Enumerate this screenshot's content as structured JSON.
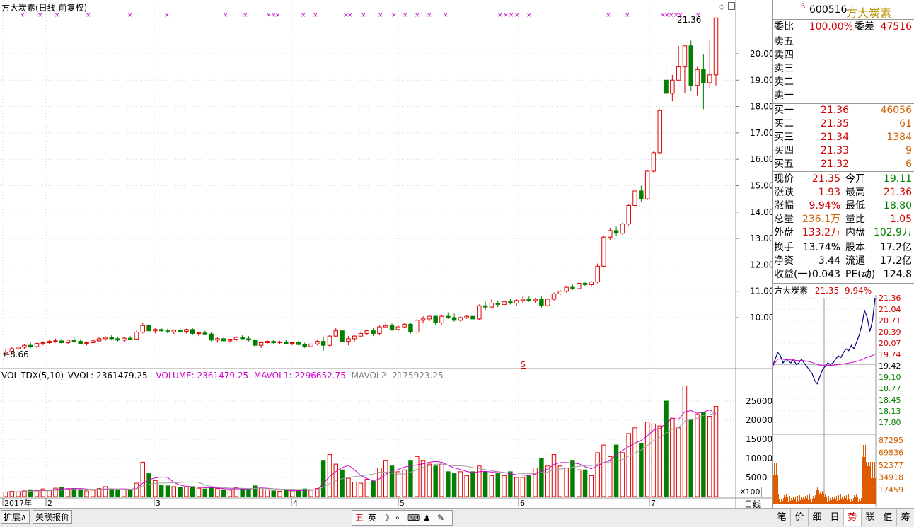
{
  "header": {
    "title": "方大炭素(日线 前复权)",
    "last_price_label": "21.36",
    "low_label": "8.66",
    "marker_s": "S"
  },
  "price_axis": [
    "20.00",
    "19.00",
    "18.00",
    "17.00",
    "16.00",
    "15.00",
    "14.00",
    "13.00",
    "12.00",
    "11.00",
    "10.00"
  ],
  "volume_header": {
    "name": "VOL-TDX(5,10)",
    "vvol": "VVOL: 2361479.25",
    "volume": "VOLUME: 2361479.25",
    "mavol1": "MAVOL1: 2296652.75",
    "mavol2": "MAVOL2: 2175923.25"
  },
  "volume_axis": [
    "25000",
    "20000",
    "15000",
    "10000",
    "5000"
  ],
  "volume_unit": "X100",
  "date_axis": [
    "2017年",
    "2",
    "3",
    "4",
    "5",
    "6",
    "7"
  ],
  "period_button": "日线",
  "chart_data": {
    "type": "candlestick",
    "title": "方大炭素(日线 前复权)",
    "price_range": [
      8.5,
      21.5
    ],
    "volume_range": [
      0,
      30000
    ],
    "colors": {
      "up": "#e00000",
      "down": "#008000",
      "ma1": "#d000d0",
      "ma2": "#a0a0a0"
    },
    "dates_months": [
      "2017年",
      "2",
      "3",
      "4",
      "5",
      "6",
      "7"
    ],
    "candles": [
      [
        8.66,
        8.8,
        8.6,
        8.7,
        1200
      ],
      [
        8.7,
        8.9,
        8.65,
        8.82,
        1400
      ],
      [
        8.82,
        8.95,
        8.75,
        8.88,
        1300
      ],
      [
        8.88,
        9.0,
        8.8,
        8.95,
        1500
      ],
      [
        8.95,
        9.05,
        8.85,
        8.9,
        1800
      ],
      [
        8.9,
        9.05,
        8.85,
        9.02,
        1600
      ],
      [
        9.02,
        9.1,
        8.95,
        9.05,
        2000
      ],
      [
        9.05,
        9.15,
        9.0,
        9.1,
        1700
      ],
      [
        9.1,
        9.2,
        9.05,
        9.12,
        2200
      ],
      [
        9.12,
        9.2,
        9.0,
        9.05,
        2500
      ],
      [
        9.05,
        9.18,
        9.0,
        9.15,
        2000
      ],
      [
        9.15,
        9.25,
        9.05,
        9.1,
        2100
      ],
      [
        9.1,
        9.18,
        9.0,
        9.02,
        1800
      ],
      [
        9.02,
        9.1,
        8.95,
        9.05,
        1500
      ],
      [
        9.05,
        9.15,
        9.0,
        9.12,
        1700
      ],
      [
        9.12,
        9.25,
        9.08,
        9.2,
        2100
      ],
      [
        9.2,
        9.3,
        9.12,
        9.25,
        2600
      ],
      [
        9.25,
        9.35,
        9.15,
        9.2,
        2000
      ],
      [
        9.2,
        9.28,
        9.1,
        9.15,
        1600
      ],
      [
        9.15,
        9.25,
        9.08,
        9.22,
        1800
      ],
      [
        9.22,
        9.3,
        9.15,
        9.18,
        1700
      ],
      [
        9.18,
        9.5,
        9.15,
        9.45,
        3500
      ],
      [
        9.45,
        9.8,
        9.4,
        9.7,
        9000
      ],
      [
        9.7,
        9.75,
        9.45,
        9.5,
        6000
      ],
      [
        9.5,
        9.6,
        9.4,
        9.55,
        4200
      ],
      [
        9.55,
        9.62,
        9.45,
        9.5,
        3000
      ],
      [
        9.5,
        9.58,
        9.4,
        9.45,
        2800
      ],
      [
        9.45,
        9.55,
        9.38,
        9.52,
        2600
      ],
      [
        9.52,
        9.6,
        9.42,
        9.48,
        2400
      ],
      [
        9.48,
        9.58,
        9.4,
        9.55,
        2500
      ],
      [
        9.55,
        9.6,
        9.35,
        9.4,
        2600
      ],
      [
        9.4,
        9.48,
        9.3,
        9.42,
        2200
      ],
      [
        9.42,
        9.5,
        9.35,
        9.38,
        2000
      ],
      [
        9.38,
        9.45,
        9.1,
        9.15,
        2400
      ],
      [
        9.15,
        9.25,
        9.05,
        9.2,
        2100
      ],
      [
        9.2,
        9.28,
        9.1,
        9.12,
        1800
      ],
      [
        9.12,
        9.2,
        9.05,
        9.18,
        1700
      ],
      [
        9.18,
        9.3,
        9.1,
        9.25,
        2300
      ],
      [
        9.25,
        9.35,
        9.15,
        9.2,
        2100
      ],
      [
        9.2,
        9.3,
        9.1,
        9.15,
        2000
      ],
      [
        9.15,
        9.22,
        8.85,
        8.95,
        2800
      ],
      [
        8.95,
        9.1,
        8.85,
        9.05,
        2200
      ],
      [
        9.05,
        9.15,
        9.0,
        9.1,
        1800
      ],
      [
        9.1,
        9.15,
        9.0,
        9.05,
        1500
      ],
      [
        9.05,
        9.12,
        8.98,
        9.08,
        1400
      ],
      [
        9.08,
        9.15,
        9.0,
        9.02,
        1600
      ],
      [
        9.02,
        9.08,
        8.95,
        9.05,
        1500
      ],
      [
        9.05,
        9.12,
        8.95,
        8.98,
        1800
      ],
      [
        8.98,
        9.05,
        8.85,
        8.9,
        2000
      ],
      [
        8.9,
        9.05,
        8.85,
        9.0,
        1700
      ],
      [
        9.0,
        9.15,
        8.95,
        9.1,
        2100
      ],
      [
        9.1,
        9.25,
        8.75,
        8.95,
        9500
      ],
      [
        8.95,
        9.35,
        8.9,
        9.3,
        11000
      ],
      [
        9.3,
        9.6,
        9.25,
        9.5,
        8500
      ],
      [
        9.5,
        9.55,
        9.0,
        9.1,
        7000
      ],
      [
        9.1,
        9.3,
        8.95,
        9.2,
        4800
      ],
      [
        9.2,
        9.35,
        9.1,
        9.3,
        3800
      ],
      [
        9.3,
        9.45,
        9.25,
        9.4,
        3500
      ],
      [
        9.4,
        9.55,
        9.35,
        9.5,
        4500
      ],
      [
        9.5,
        9.6,
        9.3,
        9.4,
        4000
      ],
      [
        9.4,
        9.7,
        9.35,
        9.65,
        7500
      ],
      [
        9.65,
        9.85,
        9.6,
        9.7,
        9500
      ],
      [
        9.7,
        9.78,
        9.5,
        9.55,
        8000
      ],
      [
        9.55,
        9.7,
        9.5,
        9.65,
        6500
      ],
      [
        9.65,
        9.8,
        9.6,
        9.75,
        7000
      ],
      [
        9.75,
        9.8,
        9.4,
        9.45,
        9500
      ],
      [
        9.45,
        9.95,
        9.4,
        9.9,
        10500
      ],
      [
        9.9,
        10.05,
        9.8,
        9.95,
        9500
      ],
      [
        9.95,
        10.1,
        9.85,
        10.05,
        8500
      ],
      [
        10.05,
        10.1,
        9.7,
        9.8,
        8000
      ],
      [
        9.8,
        10.1,
        9.75,
        10.05,
        8500
      ],
      [
        10.05,
        10.2,
        9.95,
        10.0,
        6500
      ],
      [
        10.0,
        10.15,
        9.85,
        9.9,
        6000
      ],
      [
        9.9,
        10.05,
        9.85,
        10.0,
        6500
      ],
      [
        10.0,
        10.1,
        9.95,
        10.05,
        5500
      ],
      [
        10.05,
        10.1,
        9.9,
        9.95,
        6500
      ],
      [
        9.95,
        10.5,
        9.9,
        10.45,
        8000
      ],
      [
        10.45,
        10.6,
        10.3,
        10.4,
        6500
      ],
      [
        10.4,
        10.7,
        10.35,
        10.55,
        5500
      ],
      [
        10.55,
        10.65,
        10.4,
        10.5,
        6000
      ],
      [
        10.5,
        10.65,
        10.45,
        10.6,
        5500
      ],
      [
        10.6,
        10.7,
        10.5,
        10.55,
        6500
      ],
      [
        10.55,
        10.7,
        10.45,
        10.65,
        5000
      ],
      [
        10.65,
        10.8,
        10.55,
        10.7,
        5000
      ],
      [
        10.7,
        10.8,
        10.6,
        10.65,
        5500
      ],
      [
        10.65,
        10.75,
        10.55,
        10.7,
        7500
      ],
      [
        10.7,
        10.8,
        10.35,
        10.45,
        10000
      ],
      [
        10.45,
        10.75,
        10.4,
        10.7,
        8000
      ],
      [
        10.7,
        10.95,
        10.65,
        10.9,
        11000
      ],
      [
        10.9,
        11.05,
        10.85,
        11.0,
        8000
      ],
      [
        11.0,
        11.2,
        10.95,
        11.15,
        7500
      ],
      [
        11.15,
        11.25,
        11.05,
        11.1,
        9500
      ],
      [
        11.1,
        11.35,
        11.05,
        11.3,
        7000
      ],
      [
        11.3,
        11.35,
        11.2,
        11.25,
        7000
      ],
      [
        11.25,
        11.4,
        11.15,
        11.35,
        5500
      ],
      [
        11.35,
        12.05,
        11.3,
        11.95,
        11500
      ],
      [
        11.95,
        13.1,
        11.9,
        13.05,
        13500
      ],
      [
        13.05,
        13.4,
        12.95,
        13.3,
        10500
      ],
      [
        13.3,
        13.45,
        13.1,
        13.2,
        13500
      ],
      [
        13.2,
        13.6,
        13.15,
        13.55,
        11500
      ],
      [
        13.55,
        14.3,
        13.5,
        14.25,
        16500
      ],
      [
        14.25,
        15.0,
        14.2,
        14.8,
        18000
      ],
      [
        14.8,
        15.0,
        14.4,
        14.5,
        14000
      ],
      [
        14.5,
        15.6,
        14.45,
        15.55,
        19500
      ],
      [
        15.55,
        16.3,
        15.5,
        16.25,
        19000
      ],
      [
        16.25,
        17.9,
        16.2,
        17.85,
        18500
      ],
      [
        19.0,
        19.6,
        18.3,
        18.5,
        25000
      ],
      [
        18.5,
        19.2,
        18.2,
        19.0,
        20500
      ],
      [
        19.0,
        20.3,
        19.0,
        19.5,
        18000
      ],
      [
        19.5,
        20.3,
        18.5,
        20.3,
        29000
      ],
      [
        20.3,
        20.5,
        18.6,
        18.8,
        20000
      ],
      [
        18.8,
        19.5,
        18.4,
        19.4,
        21500
      ],
      [
        19.4,
        20.0,
        17.9,
        18.9,
        22000
      ],
      [
        18.9,
        20.5,
        18.7,
        19.2,
        21000
      ],
      [
        19.2,
        21.36,
        18.8,
        21.36,
        23600
      ]
    ]
  },
  "right_panel": {
    "flag": "R",
    "code": "600516",
    "name": "方大炭素",
    "wb_label": "委比",
    "wb_value": "100.00%",
    "wc_label": "委差",
    "wc_value": "47516",
    "sell": [
      {
        "label": "卖五",
        "price": "",
        "vol": ""
      },
      {
        "label": "卖四",
        "price": "",
        "vol": ""
      },
      {
        "label": "卖三",
        "price": "",
        "vol": ""
      },
      {
        "label": "卖二",
        "price": "",
        "vol": ""
      },
      {
        "label": "卖一",
        "price": "",
        "vol": ""
      }
    ],
    "buy": [
      {
        "label": "买一",
        "price": "21.36",
        "vol": "46056"
      },
      {
        "label": "买二",
        "price": "21.35",
        "vol": "61"
      },
      {
        "label": "买三",
        "price": "21.34",
        "vol": "1384"
      },
      {
        "label": "买四",
        "price": "21.33",
        "vol": "9"
      },
      {
        "label": "买五",
        "price": "21.32",
        "vol": "6"
      }
    ],
    "quote": [
      {
        "l1": "现价",
        "v1": "21.35",
        "l2": "今开",
        "v2": "19.11"
      },
      {
        "l1": "涨跌",
        "v1": "1.93",
        "l2": "最高",
        "v2": "21.36"
      },
      {
        "l1": "涨幅",
        "v1": "9.94%",
        "l2": "最低",
        "v2": "18.80"
      },
      {
        "l1": "总量",
        "v1": "236.1万",
        "l2": "量比",
        "v2": "1.05"
      },
      {
        "l1": "外盘",
        "v1": "133.2万",
        "l2": "内盘",
        "v2": "102.9万"
      }
    ],
    "fin": [
      {
        "l1": "换手",
        "v1": "13.74%",
        "l2": "股本",
        "v2": "17.2亿"
      },
      {
        "l1": "净资",
        "v1": "3.44",
        "l2": "流通",
        "v2": "17.2亿"
      },
      {
        "l1": "收益(一)",
        "v1": "0.043",
        "l2": "PE(动)",
        "v2": "124.8"
      }
    ],
    "mini": {
      "name": "方大炭素",
      "price": "21.35",
      "pct": "9.94%",
      "price_axis": [
        "21.36",
        "21.04",
        "20.71",
        "20.39",
        "20.07",
        "19.74",
        "19.42",
        "19.10",
        "18.77",
        "18.45",
        "18.13",
        "17.80"
      ],
      "vol_axis": [
        "87295",
        "69836",
        "52377",
        "34918",
        "17459"
      ]
    },
    "tabs": [
      "笔",
      "价",
      "细",
      "日",
      "势",
      "联",
      "值",
      "筹"
    ]
  },
  "statusbar": {
    "expand": "扩展∧",
    "related": "关联报价",
    "icons": [
      "五",
      "英"
    ]
  }
}
